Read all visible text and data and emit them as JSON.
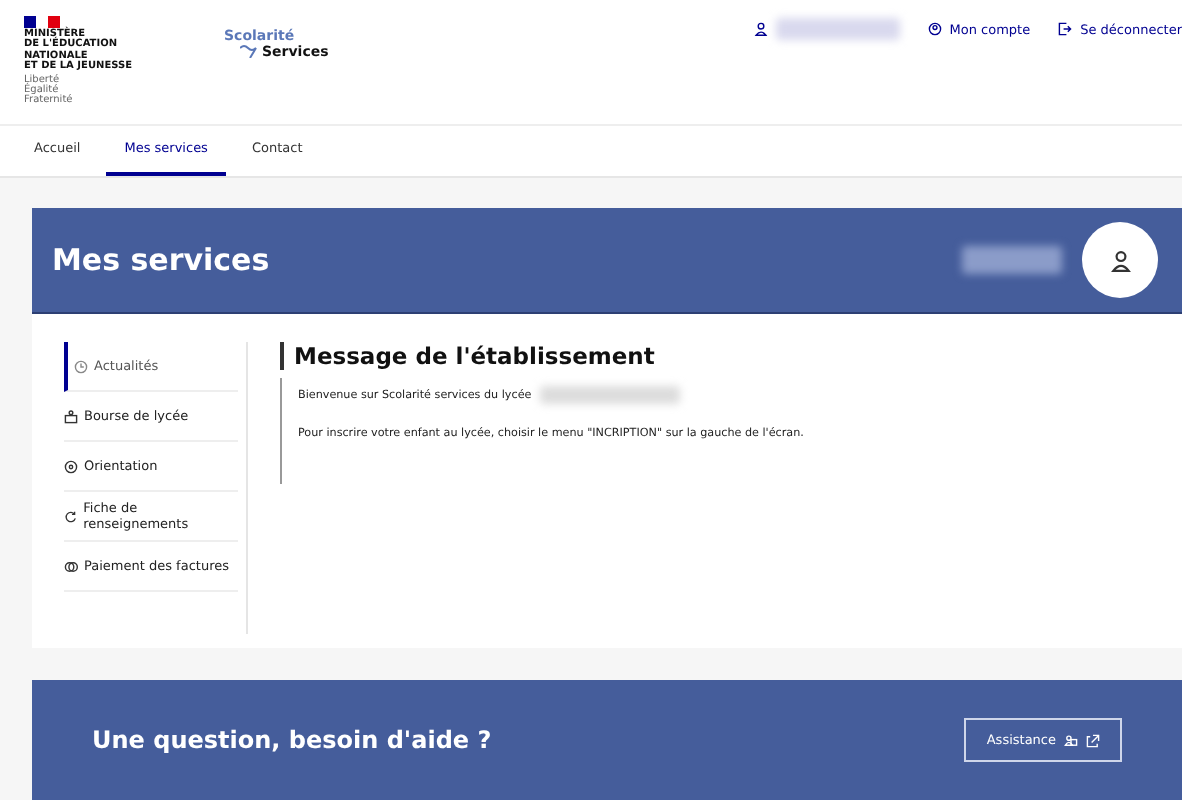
{
  "header": {
    "ministry": "MINISTÈRE\nDE L'ÉDUCATION\nNATIONALE\nET DE LA JEUNESSE",
    "motto": "Liberté\nÉgalité\nFraternité",
    "brand_top": "Scolarité",
    "brand_bottom": "Services",
    "account": "Mon compte",
    "logout": "Se déconnecter"
  },
  "nav": [
    {
      "label": "Accueil",
      "selected": false
    },
    {
      "label": "Mes services",
      "selected": true
    },
    {
      "label": "Contact",
      "selected": false
    }
  ],
  "banner": {
    "title": "Mes services"
  },
  "sidebar": [
    {
      "label": "Actualités",
      "kind": "clock",
      "selected": true
    },
    {
      "label": "Bourse de lycée",
      "kind": "money",
      "selected": false
    },
    {
      "label": "Orientation",
      "kind": "compass",
      "selected": false
    },
    {
      "label": "Fiche de renseignements",
      "kind": "refresh",
      "selected": false
    },
    {
      "label": "Paiement des factures",
      "kind": "coins",
      "selected": false
    }
  ],
  "message": {
    "title": "Message de l'établissement",
    "lines": [
      "Bienvenue sur Scolarité services du lycée",
      "Pour inscrire votre enfant au lycée, choisir le menu \"INCRIPTION\" sur la gauche de l'écran."
    ]
  },
  "help": {
    "title": "Une question, besoin d'aide ?",
    "button": "Assistance"
  }
}
